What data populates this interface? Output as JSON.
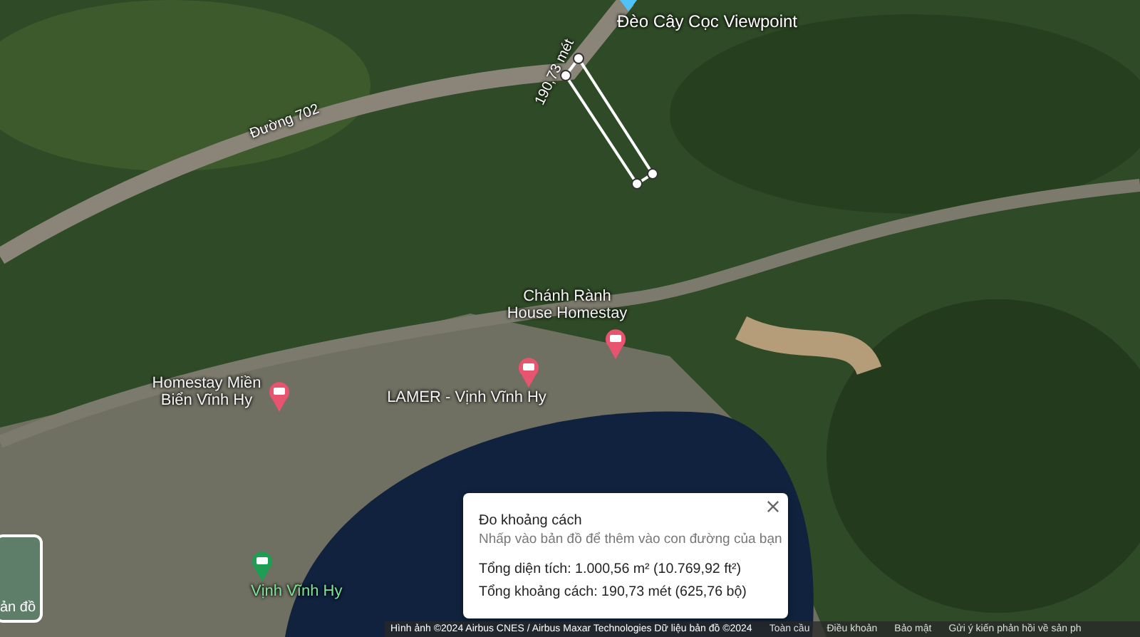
{
  "map": {
    "places": [
      {
        "name": "Đèo Cây Cọc Viewpoint",
        "kind": "viewpoint"
      },
      {
        "name": "Đường 702",
        "kind": "road"
      },
      {
        "name": "190,73 mét",
        "kind": "measure"
      },
      {
        "name": "Chánh Rành House Homestay",
        "kind": "hotel"
      },
      {
        "name": "Homestay Miền Biển Vĩnh Hy",
        "kind": "hotel"
      },
      {
        "name": "LAMER - Vịnh Vĩnh Hy",
        "kind": "hotel"
      },
      {
        "name": "Vịnh Vĩnh Hy",
        "kind": "transit"
      }
    ]
  },
  "layer_button": {
    "label": "ản đồ"
  },
  "measure_panel": {
    "title": "Đo khoảng cách",
    "hint": "Nhấp vào bản đồ để thêm vào con đường của bạn",
    "area": "Tổng diện tích: 1.000,56 m² (10.769,92 ft²)",
    "distance": "Tổng khoảng cách: 190,73 mét (625,76 bộ)"
  },
  "footer": {
    "attribution": "Hình ảnh ©2024 Airbus CNES / Airbus Maxar Technologies Dữ liệu bản đồ ©2024",
    "links": [
      "Toàn cầu",
      "Điều khoản",
      "Bảo mật",
      "Gửi ý kiến phản hồi về sản ph"
    ]
  }
}
